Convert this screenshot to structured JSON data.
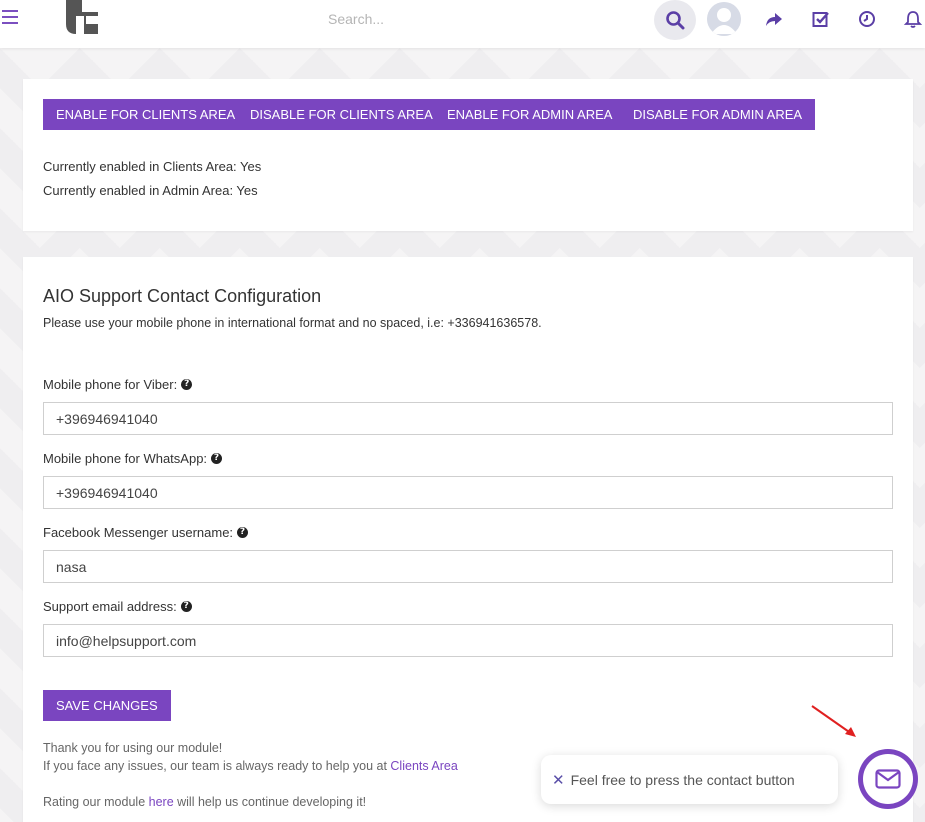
{
  "header": {
    "search_placeholder": "Search..."
  },
  "area_buttons": {
    "enable_clients": "ENABLE FOR CLIENTS AREA",
    "disable_clients": "DISABLE FOR CLIENTS AREA",
    "enable_admin": "ENABLE FOR ADMIN AREA",
    "disable_admin": "DISABLE FOR ADMIN AREA"
  },
  "status": {
    "clients": "Currently enabled in Clients Area: Yes",
    "admin": "Currently enabled in Admin Area: Yes"
  },
  "config": {
    "title": "AIO Support Contact Configuration",
    "description": "Please use your mobile phone in international format and no spaced, i.e: +336941636578.",
    "fields": [
      {
        "label": "Mobile phone for Viber:",
        "value": "+396946941040"
      },
      {
        "label": "Mobile phone for WhatsApp:",
        "value": "+396946941040"
      },
      {
        "label": "Facebook Messenger username:",
        "value": "nasa"
      },
      {
        "label": "Support email address:",
        "value": "info@helpsupport.com"
      }
    ],
    "save_label": "SAVE CHANGES"
  },
  "footer": {
    "thanks": "Thank you for using our module!",
    "issues_prefix": "If you face any issues, our team is always ready to help you at ",
    "issues_link": "Clients Area",
    "rating_prefix": "Rating our module ",
    "rating_link": "here",
    "rating_suffix": " will help us continue developing it!"
  },
  "widget": {
    "tooltip": "Feel free to press the contact button"
  },
  "colors": {
    "accent": "#7a45c0",
    "arrow": "#e02020"
  }
}
